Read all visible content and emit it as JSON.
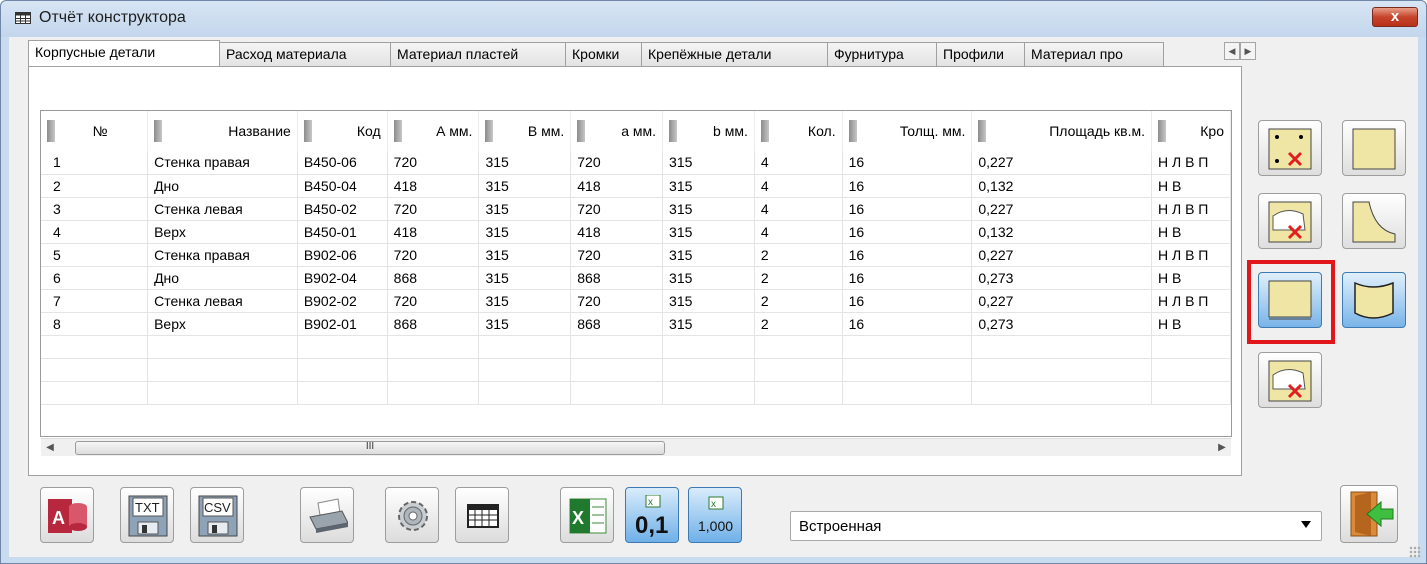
{
  "window": {
    "title": "Отчёт конструктора",
    "close_glyph": "x"
  },
  "tabs": [
    "Корпусные детали",
    "Расход материала",
    "Материал пластей",
    "Кромки",
    "Крепёжные детали",
    "Фурнитура",
    "Профили",
    "Материал про"
  ],
  "table": {
    "columns": [
      "№",
      "Название",
      "Код",
      "А мм.",
      "В мм.",
      "а мм.",
      "b мм.",
      "Кол.",
      "Толщ. мм.",
      "Площадь кв.м.",
      "Кро"
    ],
    "rows": [
      [
        "1",
        "Стенка правая",
        "B450-06",
        "720",
        "315",
        "720",
        "315",
        "4",
        "16",
        "0,227",
        "Н Л В П"
      ],
      [
        "2",
        "Дно",
        "B450-04",
        "418",
        "315",
        "418",
        "315",
        "4",
        "16",
        "0,132",
        "Н В"
      ],
      [
        "3",
        "Стенка левая",
        "B450-02",
        "720",
        "315",
        "720",
        "315",
        "4",
        "16",
        "0,227",
        "Н Л В П"
      ],
      [
        "4",
        "Верх",
        "B450-01",
        "418",
        "315",
        "418",
        "315",
        "4",
        "16",
        "0,132",
        "Н В"
      ],
      [
        "5",
        "Стенка правая",
        "B902-06",
        "720",
        "315",
        "720",
        "315",
        "2",
        "16",
        "0,227",
        "Н Л В П"
      ],
      [
        "6",
        "Дно",
        "B902-04",
        "868",
        "315",
        "868",
        "315",
        "2",
        "16",
        "0,273",
        "Н В"
      ],
      [
        "7",
        "Стенка левая",
        "B902-02",
        "720",
        "315",
        "720",
        "315",
        "2",
        "16",
        "0,227",
        "Н Л В П"
      ],
      [
        "8",
        "Верх",
        "B902-01",
        "868",
        "315",
        "868",
        "315",
        "2",
        "16",
        "0,273",
        "Н В"
      ]
    ],
    "scroll_thumb_label": "III"
  },
  "bottom": {
    "txt_label": "TXT",
    "csv_label": "CSV",
    "excel_decimal_label": "0,1",
    "excel_thousand_label": "1,000",
    "report_select_value": "Встроенная"
  },
  "colors": {
    "accent_highlight": "#e2171b",
    "panel_fill": "#efe6a6"
  }
}
